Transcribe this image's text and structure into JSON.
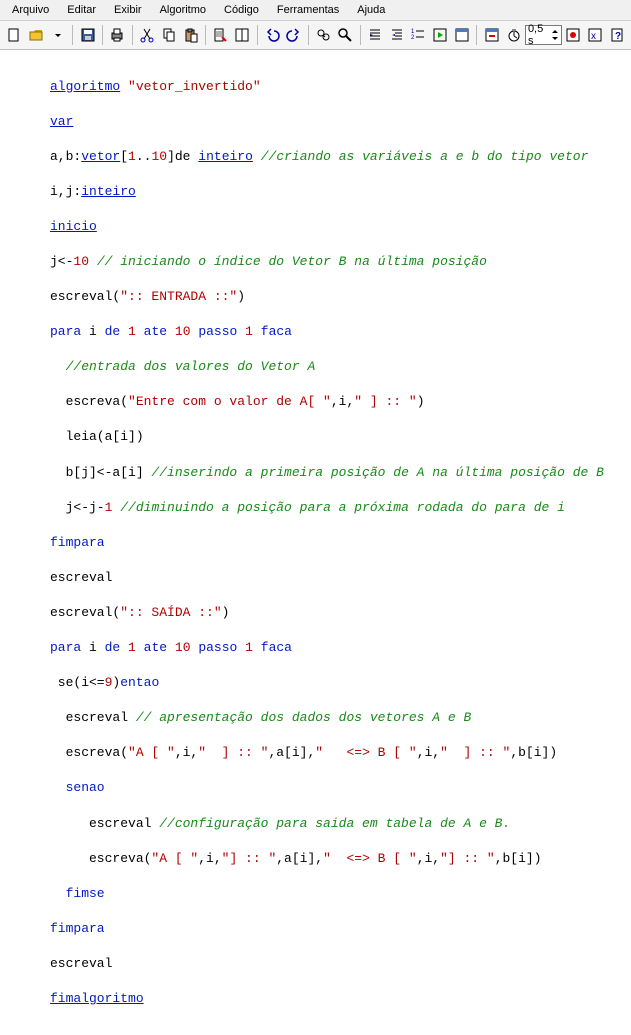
{
  "menu": {
    "file": "Arquivo",
    "edit": "Editar",
    "view": "Exibir",
    "algo": "Algoritmo",
    "code": "Código",
    "tools": "Ferramentas",
    "help": "Ajuda"
  },
  "toolbar": {
    "spin": "0,5 s"
  },
  "code": {
    "l1_k": "algoritmo",
    "l1_s": "\"vetor_invertido\"",
    "l2": "var",
    "l3_a": "a,b:",
    "l3_k": "vetor",
    "l3_b": "[",
    "l3_n1": "1",
    "l3_c": "..",
    "l3_n2": "10",
    "l3_d": "]de ",
    "l3_k2": "inteiro",
    "l3_cm": "//criando as variáveis a e b do tipo vetor",
    "l4_a": "i,j:",
    "l4_k": "inteiro",
    "l5": "inicio",
    "l6_a": "j<-",
    "l6_n": "10",
    "l6_cm": "// iniciando o índice do Vetor B na última posição",
    "l7_a": "escreval(",
    "l7_s": "\":: ENTRADA ::\"",
    "l7_b": ")",
    "l8_a": "para",
    "l8_b": " i ",
    "l8_c": "de",
    "l8_n1": "1",
    "l8_d": "ate",
    "l8_n2": "10",
    "l8_e": "passo",
    "l8_n3": "1",
    "l8_f": "faca",
    "l9": "//entrada dos valores do Vetor A",
    "l10_a": "  escreva(",
    "l10_s": "\"Entre com o valor de A[ \"",
    "l10_b": ",i,",
    "l10_s2": "\" ] :: \"",
    "l10_c": ")",
    "l11": "  leia(a[i])",
    "l12_a": "  b[j]<-a[i] ",
    "l12_cm": "//inserindo a primeira posição de A na última posição de B",
    "l13_a": "  j<-j-",
    "l13_n": "1",
    "l13_cm": "//diminuindo a posição para a próxima rodada do para de i",
    "l14": "fimpara",
    "l15": "escreval",
    "l16_a": "escreval(",
    "l16_s": "\":: SAÍDA ::\"",
    "l16_b": ")",
    "l17_a": "para",
    "l17_b": " i ",
    "l17_c": "de",
    "l17_n1": "1",
    "l17_d": "ate",
    "l17_n2": "10",
    "l17_e": "passo",
    "l17_n3": "1",
    "l17_f": "faca",
    "l18_a": " se(i<=",
    "l18_n": "9",
    "l18_b": ")",
    "l18_k": "entao",
    "l19_a": "  escreval ",
    "l19_cm": "// apresentação dos dados dos vetores A e B",
    "l20_a": "  escreva(",
    "l20_s1": "\"A [ \"",
    "l20_b": ",i,",
    "l20_s2": "\"  ] :: \"",
    "l20_c": ",a[i],",
    "l20_s3": "\"   <=> B [ \"",
    "l20_d": ",i,",
    "l20_s4": "\"  ] :: \"",
    "l20_e": ",b[i])",
    "l21": "  senao",
    "l22_a": "     escreval ",
    "l22_cm": "//configuração para saida em tabela de A e B.",
    "l23_a": "     escreva(",
    "l23_s1": "\"A [ \"",
    "l23_b": ",i,",
    "l23_s2": "\"] :: \"",
    "l23_c": ",a[i],",
    "l23_s3": "\"  <=> B [ \"",
    "l23_d": ",i,",
    "l23_s4": "\"] :: \"",
    "l23_e": ",b[i])",
    "l24": "  fimse",
    "l25": "fimpara",
    "l26": "escreval",
    "l27": "fimalgoritmo"
  }
}
